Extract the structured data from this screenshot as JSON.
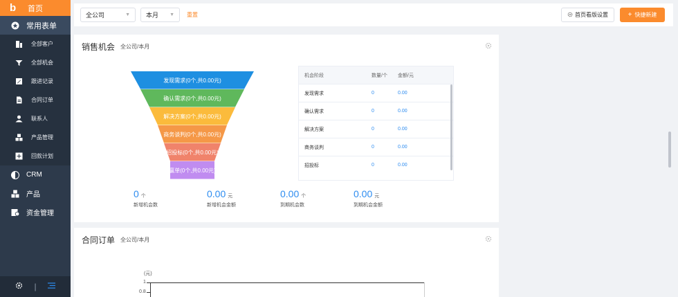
{
  "sidebar": {
    "logo": "b",
    "home": "首页",
    "common_forms": "常用表单",
    "sub_items": [
      "全部客户",
      "全部机会",
      "跟进记录",
      "合同订单",
      "联系人",
      "产品管理",
      "回款计划"
    ],
    "items": [
      "CRM",
      "产品",
      "资金管理"
    ]
  },
  "topbar": {
    "company": "全公司",
    "period": "本月",
    "reset": "重置",
    "settings": "首页看版设置",
    "quick_new": "快捷新建"
  },
  "sales": {
    "title": "销售机会",
    "subtitle": "全公司/本月",
    "funnel": [
      {
        "label": "发现需求(0个,共0.00元)",
        "color": "#1e8fe1"
      },
      {
        "label": "确认需求(0个,共0.00元)",
        "color": "#5fb85c"
      },
      {
        "label": "解决方案(0个,共0.00元)",
        "color": "#fbbb3c"
      },
      {
        "label": "商务谈判(0个,共0.00元)",
        "color": "#f59847"
      },
      {
        "label": "招投标(0个,共0.00元)",
        "color": "#f0836b"
      },
      {
        "label": "赢单(0个,共0.00元)",
        "color": "#c08cf0"
      }
    ],
    "table": {
      "headers": [
        "机会阶段",
        "数量/个",
        "金额/元"
      ],
      "rows": [
        [
          "发现需求",
          "0",
          "0.00"
        ],
        [
          "确认需求",
          "0",
          "0.00"
        ],
        [
          "解决方案",
          "0",
          "0.00"
        ],
        [
          "商务谈判",
          "0",
          "0.00"
        ],
        [
          "招投标",
          "0",
          "0.00"
        ]
      ]
    },
    "stats": [
      {
        "value": "0",
        "unit": "个",
        "label": "新增机会数"
      },
      {
        "value": "0.00",
        "unit": "元",
        "label": "新增机会金额"
      },
      {
        "value": "0.00",
        "unit": "个",
        "label": "到期机会数"
      },
      {
        "value": "0.00",
        "unit": "元",
        "label": "到期机会金额"
      }
    ]
  },
  "contracts": {
    "title": "合同订单",
    "subtitle": "全公司/本月",
    "chart": {
      "unit": "(元)",
      "ticks": [
        "1",
        "0.8"
      ]
    }
  }
}
